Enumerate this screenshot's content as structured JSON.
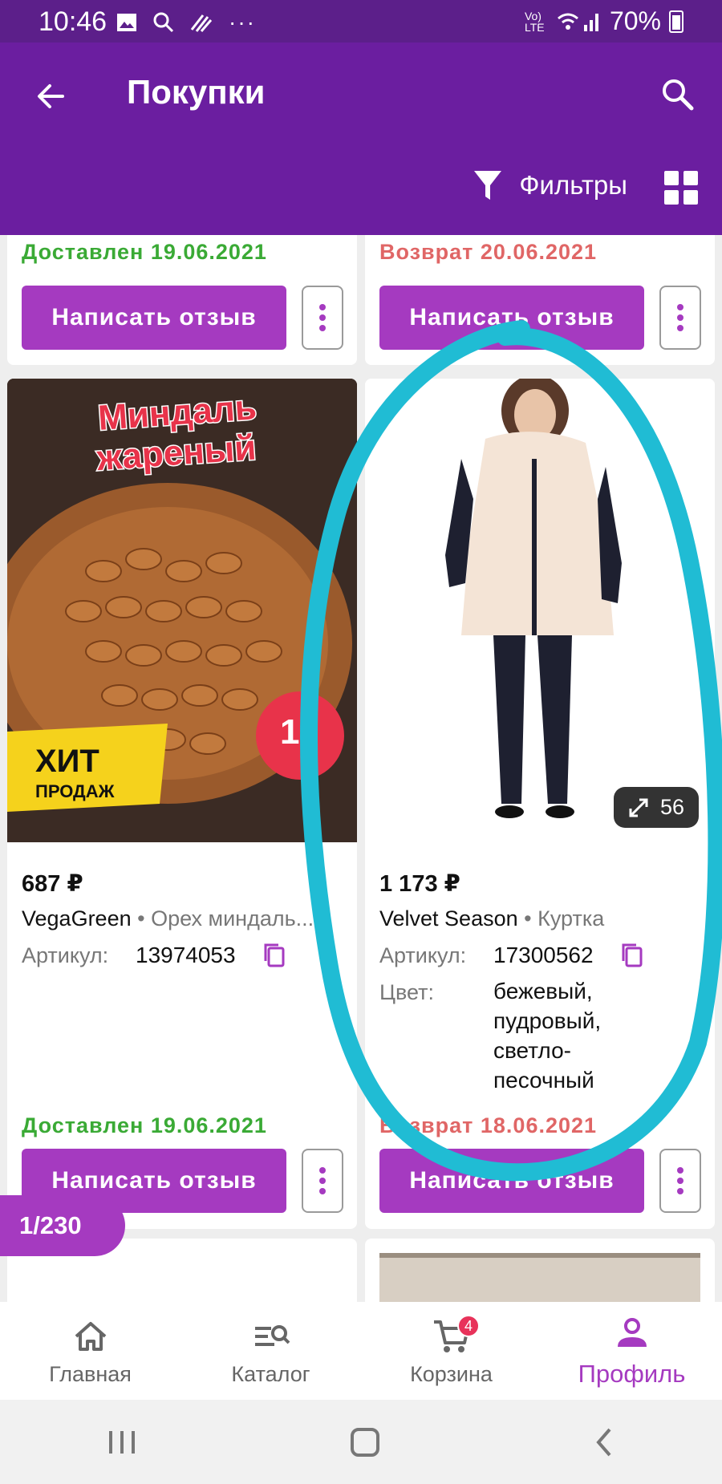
{
  "status_bar": {
    "time": "10:46",
    "battery": "70%",
    "network": "Vo) LTE"
  },
  "app_bar": {
    "title": "Покупки",
    "filters_label": "Фильтры"
  },
  "top_row": {
    "left": {
      "status": "Доставлен 19.06.2021",
      "review_label": "Написать отзыв"
    },
    "right": {
      "status": "Возврат 20.06.2021",
      "review_label": "Написать отзыв"
    }
  },
  "products": [
    {
      "image_text_title": "Миндаль жареный",
      "image_text_badge": "ХИТ ПРОДАЖ",
      "price": "687 ₽",
      "brand": "VegaGreen",
      "category": "• Орех миндаль...",
      "article_label": "Артикул:",
      "article": "13974053",
      "status": "Доставлен 19.06.2021",
      "review_label": "Написать отзыв"
    },
    {
      "photo_count": "56",
      "price": "1 173 ₽",
      "brand": "Velvet Season",
      "category": "• Куртка",
      "article_label": "Артикул:",
      "article": "17300562",
      "color_label": "Цвет:",
      "color_lines": [
        "бежевый,",
        "пудровый,",
        "светло-",
        "песочный"
      ],
      "status": "Возврат 18.06.2021",
      "review_label": "Написать отзыв"
    }
  ],
  "page_counter": "1/230",
  "bottom_nav": [
    {
      "label": "Главная",
      "icon": "home-icon"
    },
    {
      "label": "Каталог",
      "icon": "catalog-icon"
    },
    {
      "label": "Корзина",
      "icon": "cart-icon",
      "badge": "4"
    },
    {
      "label": "Профиль",
      "icon": "profile-icon",
      "active": true
    }
  ],
  "colors": {
    "primary": "#6b1ea0",
    "accent": "#a53ac0",
    "delivered": "#3aaa35",
    "returned": "#e06666",
    "annotation": "#20bcd4"
  }
}
